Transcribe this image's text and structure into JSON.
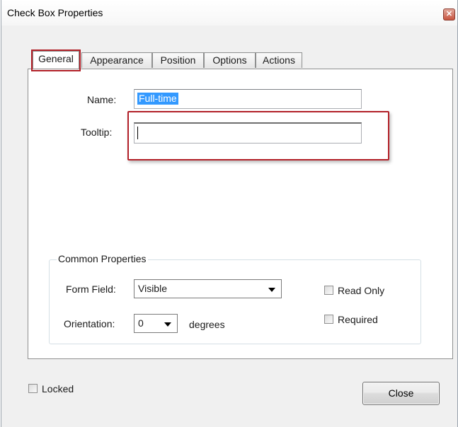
{
  "window": {
    "title": "Check Box Properties",
    "close_glyph": "✕"
  },
  "tabs": [
    {
      "label": "General",
      "active": true
    },
    {
      "label": "Appearance",
      "active": false
    },
    {
      "label": "Position",
      "active": false
    },
    {
      "label": "Options",
      "active": false
    },
    {
      "label": "Actions",
      "active": false
    }
  ],
  "general": {
    "name_label": "Name:",
    "name_value": "Full-time",
    "tooltip_label": "Tooltip:",
    "tooltip_value": ""
  },
  "common": {
    "legend": "Common Properties",
    "form_field_label": "Form Field:",
    "form_field_value": "Visible",
    "orientation_label": "Orientation:",
    "orientation_value": "0",
    "degrees_label": "degrees",
    "read_only_label": "Read Only",
    "read_only_checked": false,
    "required_label": "Required",
    "required_checked": false
  },
  "footer": {
    "locked_label": "Locked",
    "locked_checked": false,
    "close_label": "Close"
  },
  "colors": {
    "highlight_annotation": "#b22028",
    "selection": "#3399ff"
  }
}
